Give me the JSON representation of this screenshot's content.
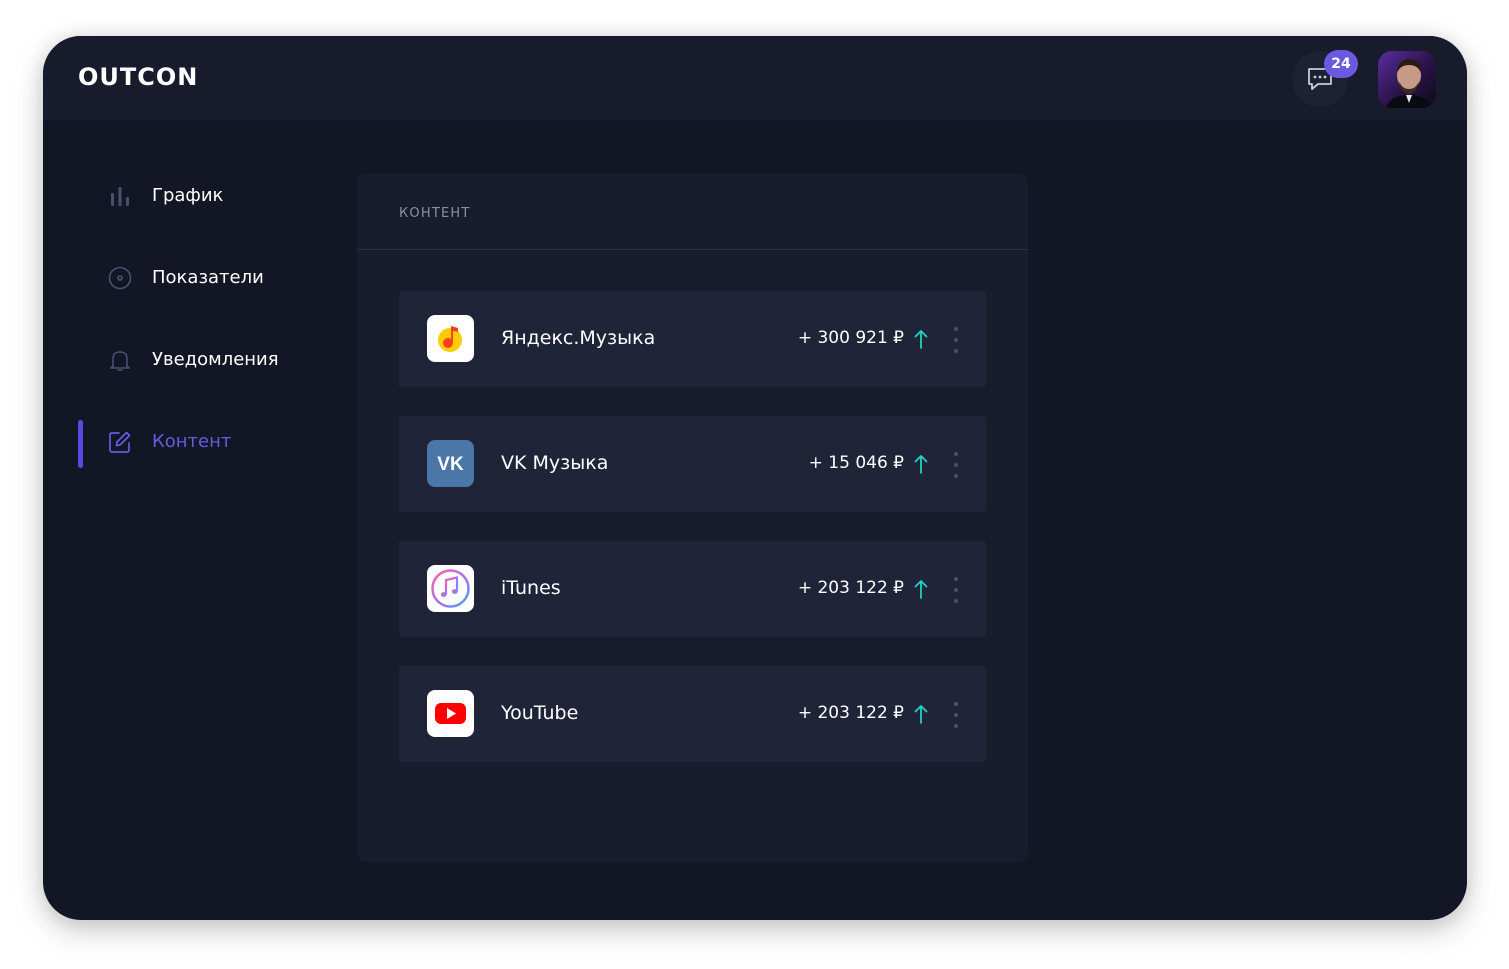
{
  "app": {
    "logo": "OUTCON"
  },
  "header": {
    "chat_badge": "24",
    "colors": {
      "badge": "#6a5ae0"
    }
  },
  "sidebar": {
    "items": [
      {
        "label": "График",
        "icon": "bar-chart-icon",
        "active": false
      },
      {
        "label": "Показатели",
        "icon": "disc-icon",
        "active": false
      },
      {
        "label": "Уведомления",
        "icon": "bell-icon",
        "active": false
      },
      {
        "label": "Контент",
        "icon": "edit-icon",
        "active": true
      }
    ],
    "colors": {
      "active": "#6a5ae0",
      "icon": "#4a5170"
    }
  },
  "panel": {
    "title": "КОНТЕНТ",
    "rows": [
      {
        "name": "Яндекс.Музыка",
        "amount": "+ 300 921 ₽",
        "icon": "yandex-music-icon",
        "trend": "up"
      },
      {
        "name": "VK Музыка",
        "amount": "+ 15 046 ₽",
        "icon": "vk-icon",
        "trend": "up"
      },
      {
        "name": "iTunes",
        "amount": "+ 203 122 ₽",
        "icon": "itunes-icon",
        "trend": "up"
      },
      {
        "name": "YouTube",
        "amount": "+ 203 122 ₽",
        "icon": "youtube-icon",
        "trend": "up"
      }
    ],
    "colors": {
      "trend_up": "#1fd4c0"
    }
  }
}
